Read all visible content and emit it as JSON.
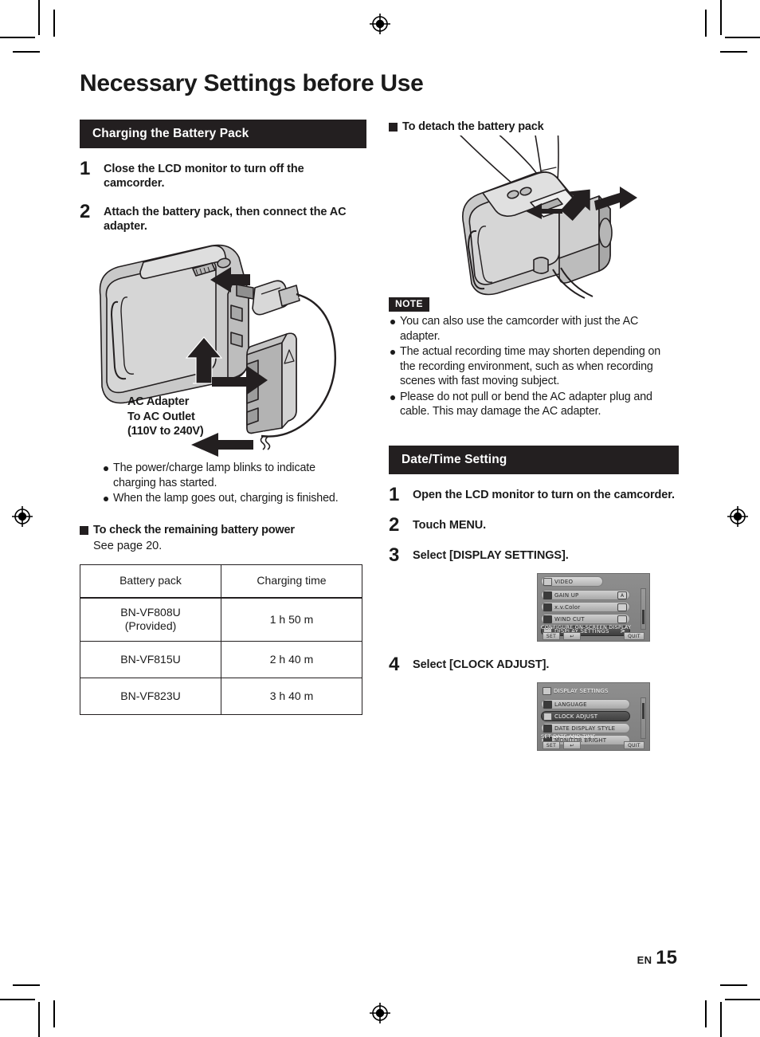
{
  "page": {
    "title": "Necessary Settings before Use",
    "footer_locale": "EN",
    "footer_page": "15"
  },
  "left_column": {
    "section_title": "Charging the Battery Pack",
    "steps": [
      {
        "num": "1",
        "text": "Close the LCD monitor to turn off the camcorder."
      },
      {
        "num": "2",
        "text": "Attach the battery pack, then connect the AC adapter."
      }
    ],
    "illustration_caption": "AC Adapter\nTo AC Outlet\n(110V to 240V)",
    "illustration_caption_line1": "AC Adapter",
    "illustration_caption_line2": "To AC Outlet",
    "illustration_caption_line3": "(110V to 240V)",
    "bullets": [
      "The power/charge lamp blinks to indicate charging has started.",
      "When the lamp goes out, charging is finished."
    ],
    "sub_heading": "To check the remaining battery power",
    "sub_heading_body": "See page 20.",
    "table": {
      "headers": [
        "Battery pack",
        "Charging time"
      ],
      "rows": [
        [
          "BN-VF808U\n(Provided)",
          "1 h 50 m"
        ],
        [
          "BN-VF815U",
          "2 h 40 m"
        ],
        [
          "BN-VF823U",
          "3 h 40 m"
        ]
      ],
      "row0_name_line1": "BN-VF808U",
      "row0_name_line2": "(Provided)",
      "row0_time": "1 h 50 m",
      "row1_name": "BN-VF815U",
      "row1_time": "2 h 40 m",
      "row2_name": "BN-VF823U",
      "row2_time": "3 h 40 m"
    }
  },
  "right_column": {
    "detach_heading": "To detach the battery pack",
    "note_label": "NOTE",
    "note_bullets": [
      "You can also use the camcorder with just the AC adapter.",
      "The actual recording time may shorten depending on the recording environment, such as when recording scenes with fast moving subject.",
      "Please do not pull or bend the AC adapter plug and cable. This may damage the AC adapter."
    ],
    "section_title": "Date/Time Setting",
    "steps": [
      {
        "num": "1",
        "text": "Open the LCD monitor to turn on the camcorder."
      },
      {
        "num": "2",
        "text": "Touch MENU."
      },
      {
        "num": "3",
        "text": "Select [DISPLAY SETTINGS]."
      },
      {
        "num": "4",
        "text": "Select [CLOCK ADJUST]."
      }
    ],
    "lcd_menu_1": {
      "breadcrumb": "VIDEO",
      "items": [
        {
          "label": "GAIN UP",
          "value": "A"
        },
        {
          "label": "x.v.Color",
          "value": ""
        },
        {
          "label": "WIND CUT",
          "value": ""
        },
        {
          "label": "DISPLAY SETTINGS",
          "value": ">",
          "selected": true
        }
      ],
      "hint": "CONFIGURE ON-SCREEN DISPLAY",
      "buttons": [
        "SET",
        "↩",
        "QUIT"
      ]
    },
    "lcd_menu_2": {
      "breadcrumb": "DISPLAY SETTINGS",
      "items": [
        {
          "label": "LANGUAGE",
          "value": ""
        },
        {
          "label": "CLOCK ADJUST",
          "value": "",
          "selected": true
        },
        {
          "label": "DATE DISPLAY STYLE",
          "value": ""
        },
        {
          "label": "MONITOR BRIGHT",
          "value": ""
        }
      ],
      "hint": "SET DATE AND TIME",
      "buttons": [
        "SET",
        "↩",
        "QUIT"
      ]
    }
  },
  "colors": {
    "ink": "#231f20",
    "paper": "#ffffff",
    "lcd_grey": "#8e8e8e",
    "lcd_selected": "#3f3f3f"
  }
}
